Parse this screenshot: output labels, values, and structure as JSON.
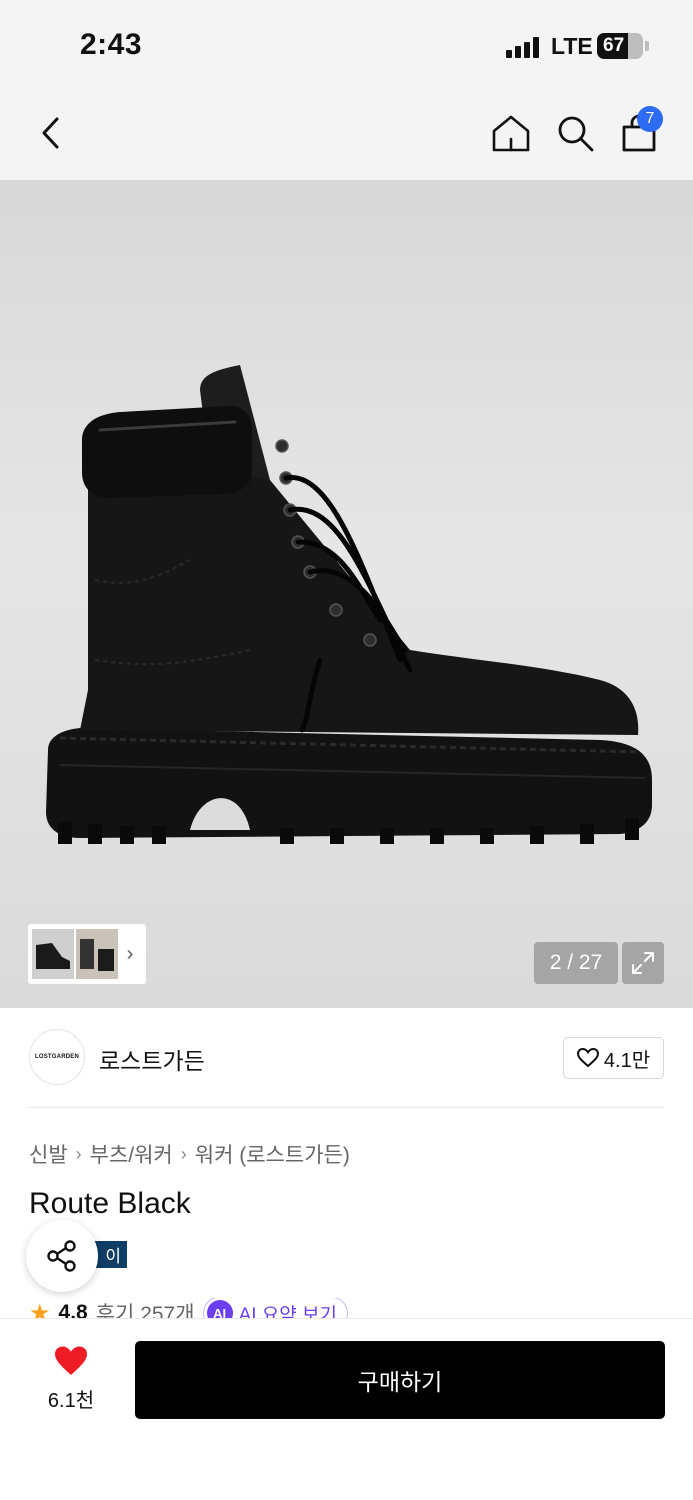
{
  "status_bar": {
    "time": "2:43",
    "network": "LTE",
    "battery": "67",
    "battery_level": 0.67
  },
  "nav": {
    "back_icon": "chevron-left-icon",
    "home_icon": "home-icon",
    "search_icon": "search-icon",
    "cart_icon": "shopping-bag-icon",
    "cart_count": "7",
    "badge_color": "#2c6bf2"
  },
  "gallery": {
    "page_current": "2",
    "page_total": "27",
    "page_label": "2 / 27",
    "expand_icon": "expand-icon",
    "thumb_next_icon": "chevron-right-icon"
  },
  "brand": {
    "logo_text": "LOSTGARDEN",
    "name": "로스트가든",
    "likes": "4.1만"
  },
  "product": {
    "breadcrumb": [
      "신발",
      "부츠/워커",
      "워커 (로스트가든)"
    ],
    "title": "Route Black",
    "tag": "이",
    "rating": "4.8",
    "reviews": "후기 257개",
    "ai_badge": "AI",
    "ai_summary": "AI 요약 보기"
  },
  "bottom": {
    "wishlist_count": "6.1천",
    "buy_label": "구매하기",
    "heart_color": "#ee1c25"
  }
}
